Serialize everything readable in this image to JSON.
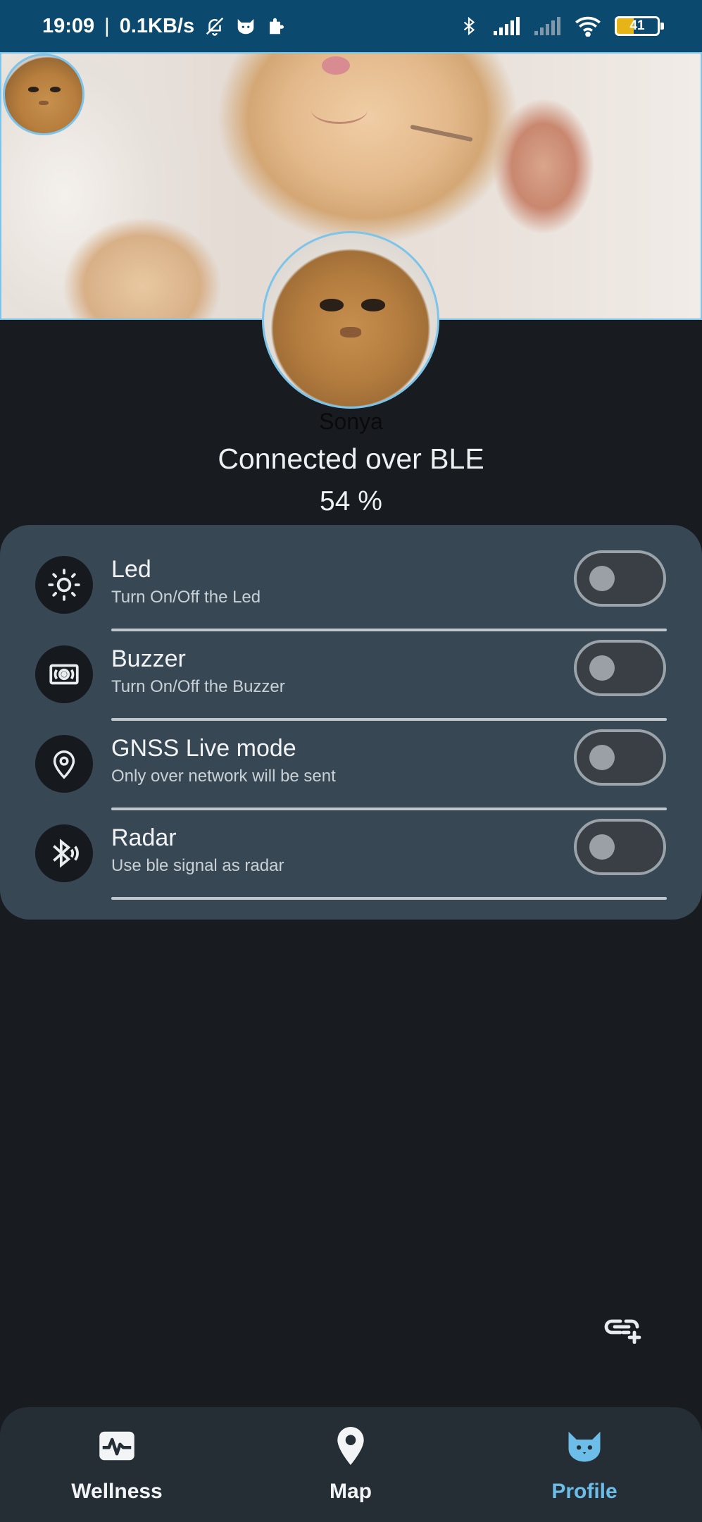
{
  "status_bar": {
    "time": "19:09",
    "separator": "|",
    "speed": "0.1KB/s",
    "battery_level": "41",
    "icons": [
      "bell-off-icon",
      "cat-icon",
      "puzzle-icon",
      "bluetooth-icon",
      "signal-icon",
      "signal-off-icon",
      "wifi-icon",
      "battery-icon"
    ]
  },
  "profile": {
    "pet_name": "Sonya",
    "connection_status": "Connected over BLE",
    "battery_percent": "54 %"
  },
  "settings": [
    {
      "title": "Led",
      "subtitle": "Turn On/Off the Led",
      "icon": "brightness-icon",
      "enabled": false
    },
    {
      "title": "Buzzer",
      "subtitle": "Turn On/Off the Buzzer",
      "icon": "speaker-icon",
      "enabled": false
    },
    {
      "title": "GNSS Live mode",
      "subtitle": "Only over network will be sent",
      "icon": "location-pin-icon",
      "enabled": false
    },
    {
      "title": "Radar",
      "subtitle": "Use ble signal as radar",
      "icon": "bluetooth-radar-icon",
      "enabled": false
    }
  ],
  "actions": {
    "add_link_icon": "add-link-icon"
  },
  "bottom_nav": {
    "items": [
      {
        "label": "Wellness",
        "icon": "heart-monitor-icon",
        "active": false
      },
      {
        "label": "Map",
        "icon": "location-pin-icon",
        "active": false
      },
      {
        "label": "Profile",
        "icon": "cat-icon",
        "active": true
      }
    ]
  },
  "colors": {
    "accent": "#6cbde8",
    "status_bar": "#0b4a6e",
    "background": "#181b1f",
    "card": "#374753",
    "nav": "#252d35"
  }
}
